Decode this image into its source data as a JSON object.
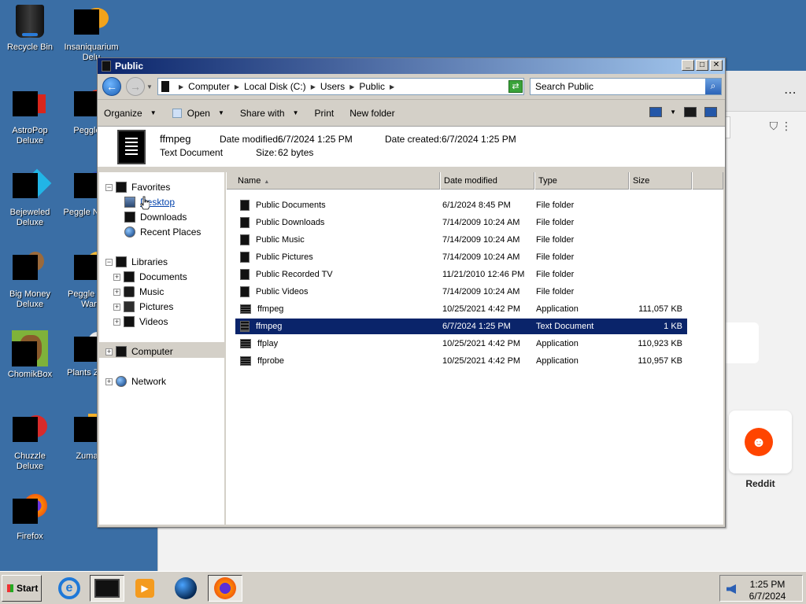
{
  "desktop": {
    "icons": [
      {
        "label": "Recycle Bin"
      },
      {
        "label": "Insaniquarium Delu"
      },
      {
        "label": "AstroPop Deluxe"
      },
      {
        "label": "Peggle D"
      },
      {
        "label": "Bejeweled Deluxe"
      },
      {
        "label": "Peggle N Delu"
      },
      {
        "label": "Big Money Deluxe"
      },
      {
        "label": "Peggle W of Ward"
      },
      {
        "label": "ChomikBox"
      },
      {
        "label": "Plants Zomb"
      },
      {
        "label": "Chuzzle Deluxe"
      },
      {
        "label": "Zuma D"
      },
      {
        "label": "Firefox"
      }
    ]
  },
  "background_browser": {
    "card_label": "Reddit",
    "card_logo": "reddit-logo"
  },
  "window": {
    "title": "Public",
    "address": {
      "crumbs": [
        "Computer",
        "Local Disk (C:)",
        "Users",
        "Public"
      ]
    },
    "search": {
      "placeholder": "Search Public"
    },
    "toolbar": {
      "organize": "Organize",
      "open": "Open",
      "share_with": "Share with",
      "print": "Print",
      "new_folder": "New folder"
    },
    "details": {
      "name": "ffmpeg",
      "type": "Text Document",
      "modified_label": "Date modified:",
      "modified_value": "6/7/2024 1:25 PM",
      "created_label": "Date created:",
      "created_value": "6/7/2024 1:25 PM",
      "size_label": "Size:",
      "size_value": "62 bytes"
    },
    "nav": {
      "favorites": "Favorites",
      "desktop": "Desktop",
      "downloads": "Downloads",
      "recent": "Recent Places",
      "libraries": "Libraries",
      "documents": "Documents",
      "music": "Music",
      "pictures": "Pictures",
      "videos": "Videos",
      "computer": "Computer",
      "network": "Network"
    },
    "columns": {
      "name": "Name",
      "date": "Date modified",
      "type": "Type",
      "size": "Size"
    },
    "files": [
      {
        "name": "Public Documents",
        "date": "6/1/2024 8:45 PM",
        "type": "File folder",
        "size": ""
      },
      {
        "name": "Public Downloads",
        "date": "7/14/2009 10:24 AM",
        "type": "File folder",
        "size": ""
      },
      {
        "name": "Public Music",
        "date": "7/14/2009 10:24 AM",
        "type": "File folder",
        "size": ""
      },
      {
        "name": "Public Pictures",
        "date": "7/14/2009 10:24 AM",
        "type": "File folder",
        "size": ""
      },
      {
        "name": "Public Recorded TV",
        "date": "11/21/2010 12:46 PM",
        "type": "File folder",
        "size": ""
      },
      {
        "name": "Public Videos",
        "date": "7/14/2009 10:24 AM",
        "type": "File folder",
        "size": ""
      },
      {
        "name": "ffmpeg",
        "date": "10/25/2021 4:42 PM",
        "type": "Application",
        "size": "111,057 KB"
      },
      {
        "name": "ffmpeg",
        "date": "6/7/2024 1:25 PM",
        "type": "Text Document",
        "size": "1 KB",
        "selected": true
      },
      {
        "name": "ffplay",
        "date": "10/25/2021 4:42 PM",
        "type": "Application",
        "size": "110,923 KB"
      },
      {
        "name": "ffprobe",
        "date": "10/25/2021 4:42 PM",
        "type": "Application",
        "size": "110,957 KB"
      }
    ]
  },
  "taskbar": {
    "start": "Start",
    "time": "1:25 PM",
    "date": "6/7/2024"
  },
  "colors": {
    "desktop_bg": "#3a6ea5",
    "selection": "#0a246a",
    "window_face": "#d4d0c8"
  }
}
